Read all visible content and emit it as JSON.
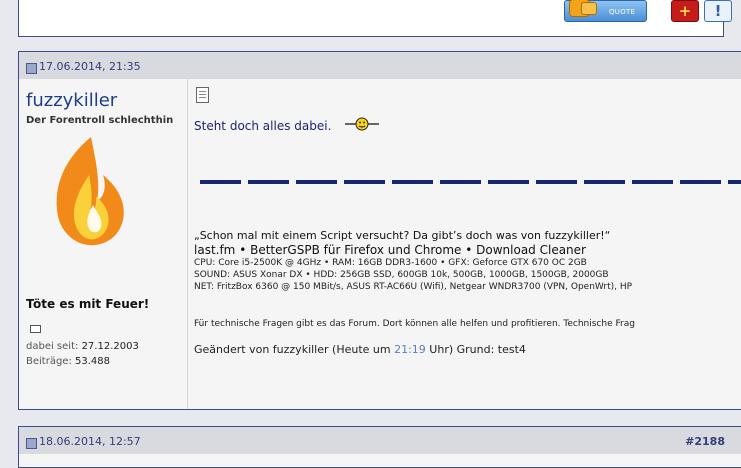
{
  "previous_post": {
    "quote_button_label": "QUOTE",
    "multiquote_icon": "multiquote-plus-icon",
    "report_icon": "report-exclamation-icon"
  },
  "post1": {
    "date": "17.06.2014, 21:35",
    "user": {
      "name": "fuzzykiller",
      "title": "Der Forentroll schlechthin",
      "motto": "Töte es mit Feuer!",
      "joined_label": "dabei seit:",
      "joined_value": "27.12.2003",
      "posts_label": "Beiträge:",
      "posts_value": "53.488"
    },
    "message": "Steht doch alles dabei.",
    "signature": {
      "quote": "„Schon mal mit einem Script versucht? Da gibt’s doch was von fuzzykiller!“",
      "links": "last.fm • BetterGSPB für Firefox und Chrome • Download Cleaner",
      "spec_cpu": "CPU: Core i5-2500K @ 4GHz • RAM: 16GB DDR3-1600 • GFX: Geforce GTX 670 OC 2GB",
      "spec_sound": "SOUND: ASUS Xonar DX • HDD: 256GB SSD, 600GB 10k, 500GB, 1000GB, 1500GB, 2000GB",
      "spec_net": "NET: FritzBox 6360 @ 150 MBit/s, ASUS RT-AC66U (Wifi), Netgear WNDR3700 (VPN, OpenWrt), HP",
      "note": "Für technische Fragen gibt es das Forum. Dort können alle helfen und profitieren. Technische Frag"
    },
    "edit": {
      "prefix": "Geändert von fuzzykiller (Heute um ",
      "time": "21:19",
      "suffix": " Uhr) Grund: test4"
    }
  },
  "post2": {
    "date": "18.06.2014, 12:57",
    "number": "#2188"
  }
}
